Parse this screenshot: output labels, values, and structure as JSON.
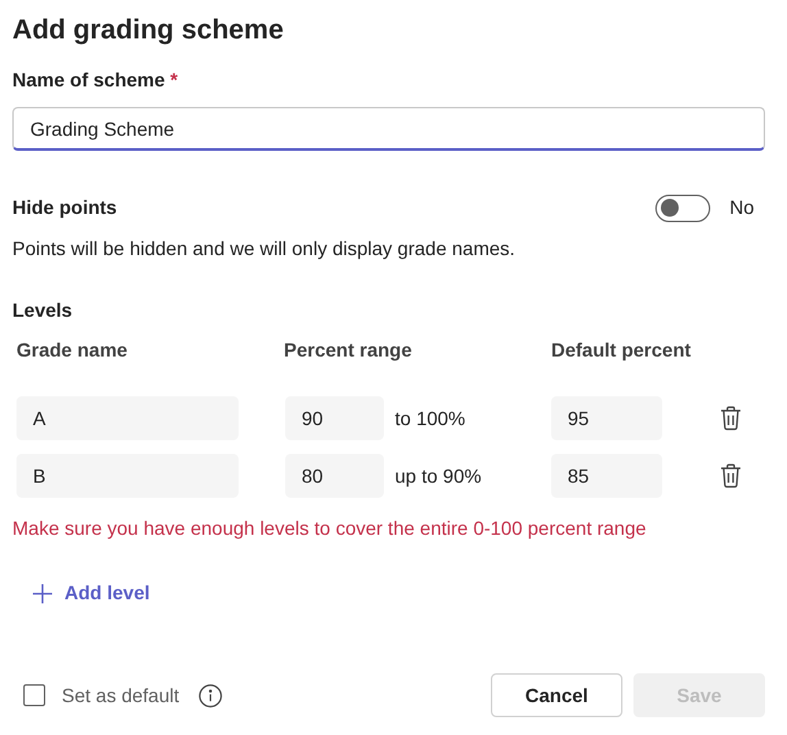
{
  "title": "Add grading scheme",
  "name_field": {
    "label": "Name of scheme",
    "required_mark": "*",
    "value": "Grading Scheme"
  },
  "hide_points": {
    "label": "Hide points",
    "on": false,
    "state_text": "No",
    "description": "Points will be hidden and we will only display grade names."
  },
  "levels": {
    "title": "Levels",
    "columns": [
      "Grade name",
      "Percent range",
      "Default percent"
    ],
    "rows": [
      {
        "grade": "A",
        "min": "90",
        "range_text": "to 100%",
        "default": "95"
      },
      {
        "grade": "B",
        "min": "80",
        "range_text": "up to 90%",
        "default": "85"
      }
    ],
    "error": "Make sure you have enough levels to cover the entire 0-100 percent range",
    "add_button": "Add level"
  },
  "footer": {
    "default_checkbox": {
      "label": "Set as default",
      "checked": false
    },
    "buttons": [
      {
        "label": "Cancel",
        "disabled": false
      },
      {
        "label": "Save",
        "disabled": true
      }
    ]
  }
}
